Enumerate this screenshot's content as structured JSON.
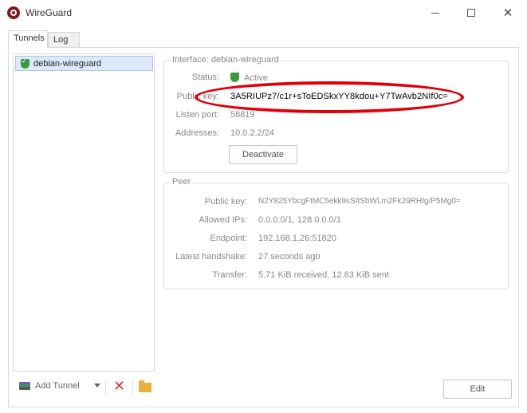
{
  "window": {
    "title": "WireGuard"
  },
  "tabs": [
    {
      "label": "Tunnels",
      "active": true
    },
    {
      "label": "Log",
      "active": false
    }
  ],
  "tunnels": [
    {
      "name": "debian-wireguard",
      "status": "active",
      "selected": true
    }
  ],
  "interface": {
    "group_title": "Interface: debian-wireguard",
    "labels": {
      "status": "Status:",
      "public_key": "Public key:",
      "listen_port": "Listen port:",
      "addresses": "Addresses:"
    },
    "status": "Active",
    "public_key": "3A5RIUPz7/c1r+sToEDSkxYY8kdou+Y7TwAvb2NIf0c=",
    "listen_port": "58819",
    "addresses": "10.0.2.2/24",
    "deactivate_label": "Deactivate"
  },
  "peer": {
    "group_title": "Peer",
    "labels": {
      "public_key": "Public key:",
      "allowed_ips": "Allowed IPs:",
      "endpoint": "Endpoint:",
      "latest_handshake": "Latest handshake:",
      "transfer": "Transfer:"
    },
    "public_key": "N2Y825YbcgFtMC5ekk9sS/tSbWLm2Fk29RHtg/P5Mg0=",
    "allowed_ips": "0.0.0.0/1, 128.0.0.0/1",
    "endpoint": "192.168.1.26:51820",
    "latest_handshake": "27 seconds ago",
    "transfer": "5.71 KiB received, 12.63 KiB sent"
  },
  "toolbar": {
    "add_tunnel_label": "Add Tunnel",
    "edit_label": "Edit"
  },
  "colors": {
    "highlight": "#e0000b",
    "active_green": "#3a9b3a",
    "selection": "#dbe9f8"
  }
}
